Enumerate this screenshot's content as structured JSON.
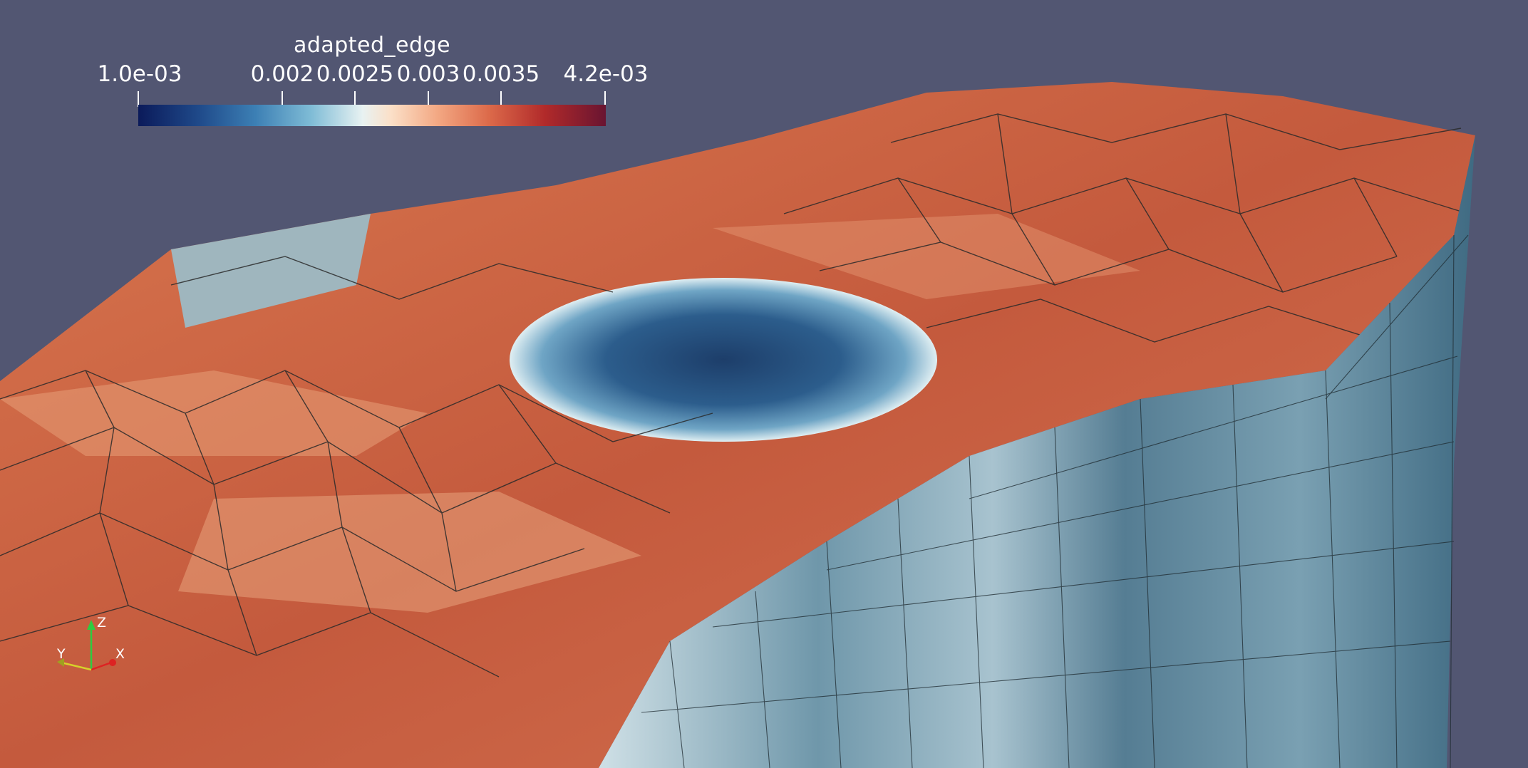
{
  "viewport": {
    "background": "#525672"
  },
  "scalar_bar": {
    "title": "adapted_edge",
    "range_min_label": "1.0e-03",
    "range_max_label": "4.2e-03",
    "ticks": [
      "0.002",
      "0.0025",
      "0.003",
      "0.0035"
    ],
    "colormap": [
      "#0b1a5a",
      "#3c7fb4",
      "#e8f2f2",
      "#dc6a4a",
      "#691431"
    ]
  },
  "orientation_axes": {
    "x_label": "X",
    "y_label": "Y",
    "z_label": "Z"
  },
  "mesh": {
    "description_colors": {
      "high": "#c85a3c",
      "low": "#2e5f8f",
      "mid": "#e9eef0"
    }
  }
}
